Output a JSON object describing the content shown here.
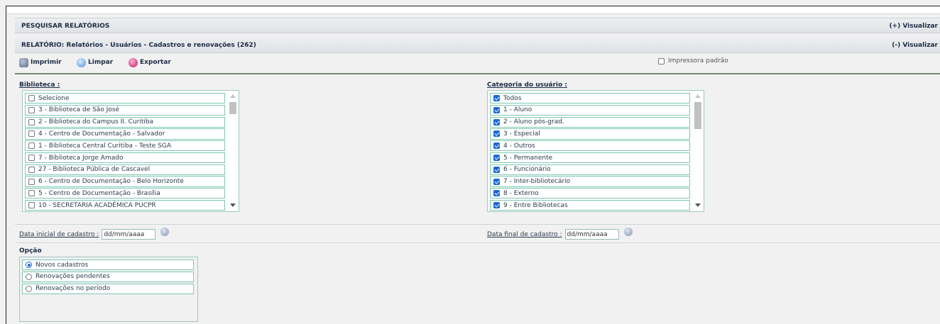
{
  "search_bar": {
    "title": "PESQUISAR RELATÓRIOS",
    "toggle": "(+) Visualizar"
  },
  "report_bar": {
    "title": "RELATÓRIO: Relatórios - Usuários - Cadastros e renovações (262)",
    "toggle": "(-) Visualizar"
  },
  "toolbar": {
    "print": {
      "label": "Imprimir",
      "icon": "printer-icon"
    },
    "clear": {
      "label": "Limpar",
      "icon": "eraser-icon"
    },
    "export": {
      "label": "Exportar",
      "icon": "export-icon"
    },
    "default_printer": {
      "label": "Impressora padrão",
      "checked": false
    }
  },
  "library": {
    "label": "Biblioteca :",
    "items": [
      {
        "label": "Selecione",
        "checked": false
      },
      {
        "label": "3 - Biblioteca de São José",
        "checked": false
      },
      {
        "label": "2 - Biblioteca do Campus II. Curitiba",
        "checked": false
      },
      {
        "label": "4 - Centro de Documentação - Salvador",
        "checked": false
      },
      {
        "label": "1 - Biblioteca Central Curitiba - Teste SGA",
        "checked": false
      },
      {
        "label": "7 - Biblioteca Jorge Amado",
        "checked": false
      },
      {
        "label": "27 - Biblioteca Pública de Cascavel",
        "checked": false
      },
      {
        "label": "6 - Centro de Documentação - Belo Horizonte",
        "checked": false
      },
      {
        "label": "5 - Centro de Documentação - Brasília",
        "checked": false
      },
      {
        "label": "10 - SECRETARIA ACADÊMICA PUCPR",
        "checked": false
      }
    ]
  },
  "user_category": {
    "label": "Categoria do usuário :",
    "items": [
      {
        "label": "Todos",
        "checked": true
      },
      {
        "label": "1 - Aluno",
        "checked": true
      },
      {
        "label": "2 - Aluno pós-grad.",
        "checked": true
      },
      {
        "label": "3 - Especial",
        "checked": true
      },
      {
        "label": "4 - Outros",
        "checked": true
      },
      {
        "label": "5 - Permanente",
        "checked": true
      },
      {
        "label": "6 - Funcionário",
        "checked": true
      },
      {
        "label": "7 - Inter-bibliotecário",
        "checked": true
      },
      {
        "label": "8 - Externo",
        "checked": true
      },
      {
        "label": "9 - Entre Bibliotecas",
        "checked": true
      }
    ]
  },
  "start_date": {
    "label": "Data inicial de cadastro :",
    "value": "dd/mm/aaaa"
  },
  "end_date": {
    "label": "Data final de cadastro :",
    "value": "dd/mm/aaaa"
  },
  "option": {
    "title": "Opção",
    "items": [
      {
        "label": "Novos cadastros",
        "selected": true
      },
      {
        "label": "Renovações pendentes",
        "selected": false
      },
      {
        "label": "Renovações no período",
        "selected": false
      }
    ]
  }
}
